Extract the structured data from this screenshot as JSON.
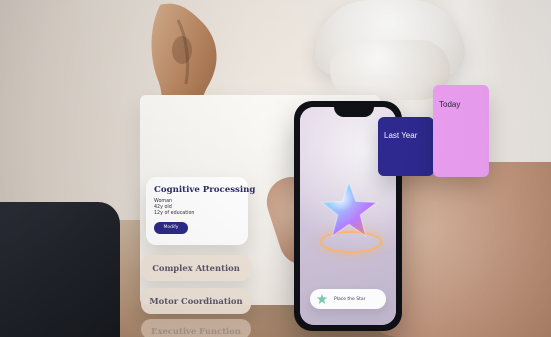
{
  "cards": {
    "cognitive_processing": {
      "title": "Cognitive Processing",
      "lines": [
        "Woman",
        "42y old",
        "12y of education"
      ],
      "button_label": "Modify"
    },
    "complex_attention": {
      "label": "Complex Attention"
    },
    "motor_coordination": {
      "label": "Motor Coordination"
    },
    "third_faded": {
      "label": "Executive Function"
    }
  },
  "tiles": {
    "last_year": {
      "label": "Last Year",
      "color": "#2e2a93"
    },
    "today": {
      "label": "Today",
      "color": "#f1a2f7"
    }
  },
  "phone": {
    "pill_label": "Place the Star"
  },
  "icons": {
    "ar_object": "star-icon",
    "mini": "star-icon"
  }
}
